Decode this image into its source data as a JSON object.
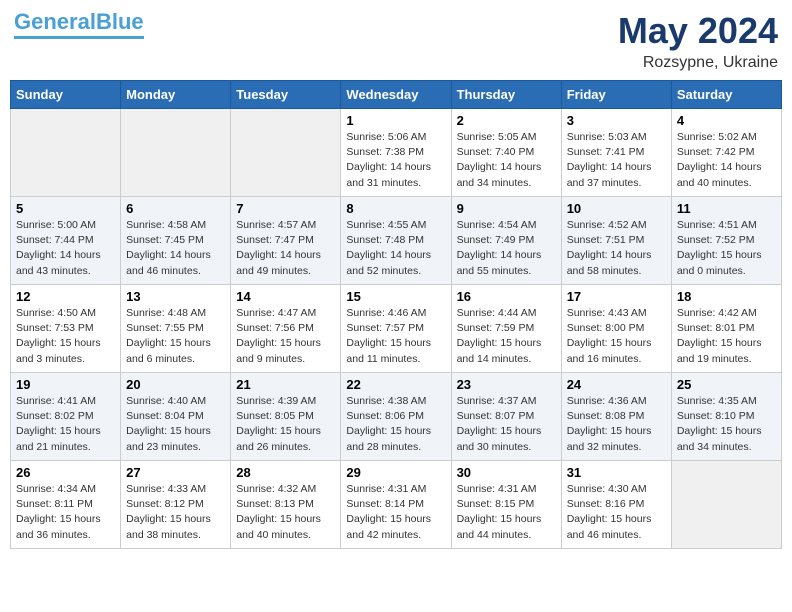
{
  "header": {
    "logo_line1": "General",
    "logo_line2": "Blue",
    "month": "May 2024",
    "location": "Rozsypne, Ukraine"
  },
  "weekdays": [
    "Sunday",
    "Monday",
    "Tuesday",
    "Wednesday",
    "Thursday",
    "Friday",
    "Saturday"
  ],
  "weeks": [
    [
      {
        "day": "",
        "empty": true
      },
      {
        "day": "",
        "empty": true
      },
      {
        "day": "",
        "empty": true
      },
      {
        "day": "1",
        "sunrise": "Sunrise: 5:06 AM",
        "sunset": "Sunset: 7:38 PM",
        "daylight": "Daylight: 14 hours and 31 minutes."
      },
      {
        "day": "2",
        "sunrise": "Sunrise: 5:05 AM",
        "sunset": "Sunset: 7:40 PM",
        "daylight": "Daylight: 14 hours and 34 minutes."
      },
      {
        "day": "3",
        "sunrise": "Sunrise: 5:03 AM",
        "sunset": "Sunset: 7:41 PM",
        "daylight": "Daylight: 14 hours and 37 minutes."
      },
      {
        "day": "4",
        "sunrise": "Sunrise: 5:02 AM",
        "sunset": "Sunset: 7:42 PM",
        "daylight": "Daylight: 14 hours and 40 minutes."
      }
    ],
    [
      {
        "day": "5",
        "sunrise": "Sunrise: 5:00 AM",
        "sunset": "Sunset: 7:44 PM",
        "daylight": "Daylight: 14 hours and 43 minutes."
      },
      {
        "day": "6",
        "sunrise": "Sunrise: 4:58 AM",
        "sunset": "Sunset: 7:45 PM",
        "daylight": "Daylight: 14 hours and 46 minutes."
      },
      {
        "day": "7",
        "sunrise": "Sunrise: 4:57 AM",
        "sunset": "Sunset: 7:47 PM",
        "daylight": "Daylight: 14 hours and 49 minutes."
      },
      {
        "day": "8",
        "sunrise": "Sunrise: 4:55 AM",
        "sunset": "Sunset: 7:48 PM",
        "daylight": "Daylight: 14 hours and 52 minutes."
      },
      {
        "day": "9",
        "sunrise": "Sunrise: 4:54 AM",
        "sunset": "Sunset: 7:49 PM",
        "daylight": "Daylight: 14 hours and 55 minutes."
      },
      {
        "day": "10",
        "sunrise": "Sunrise: 4:52 AM",
        "sunset": "Sunset: 7:51 PM",
        "daylight": "Daylight: 14 hours and 58 minutes."
      },
      {
        "day": "11",
        "sunrise": "Sunrise: 4:51 AM",
        "sunset": "Sunset: 7:52 PM",
        "daylight": "Daylight: 15 hours and 0 minutes."
      }
    ],
    [
      {
        "day": "12",
        "sunrise": "Sunrise: 4:50 AM",
        "sunset": "Sunset: 7:53 PM",
        "daylight": "Daylight: 15 hours and 3 minutes."
      },
      {
        "day": "13",
        "sunrise": "Sunrise: 4:48 AM",
        "sunset": "Sunset: 7:55 PM",
        "daylight": "Daylight: 15 hours and 6 minutes."
      },
      {
        "day": "14",
        "sunrise": "Sunrise: 4:47 AM",
        "sunset": "Sunset: 7:56 PM",
        "daylight": "Daylight: 15 hours and 9 minutes."
      },
      {
        "day": "15",
        "sunrise": "Sunrise: 4:46 AM",
        "sunset": "Sunset: 7:57 PM",
        "daylight": "Daylight: 15 hours and 11 minutes."
      },
      {
        "day": "16",
        "sunrise": "Sunrise: 4:44 AM",
        "sunset": "Sunset: 7:59 PM",
        "daylight": "Daylight: 15 hours and 14 minutes."
      },
      {
        "day": "17",
        "sunrise": "Sunrise: 4:43 AM",
        "sunset": "Sunset: 8:00 PM",
        "daylight": "Daylight: 15 hours and 16 minutes."
      },
      {
        "day": "18",
        "sunrise": "Sunrise: 4:42 AM",
        "sunset": "Sunset: 8:01 PM",
        "daylight": "Daylight: 15 hours and 19 minutes."
      }
    ],
    [
      {
        "day": "19",
        "sunrise": "Sunrise: 4:41 AM",
        "sunset": "Sunset: 8:02 PM",
        "daylight": "Daylight: 15 hours and 21 minutes."
      },
      {
        "day": "20",
        "sunrise": "Sunrise: 4:40 AM",
        "sunset": "Sunset: 8:04 PM",
        "daylight": "Daylight: 15 hours and 23 minutes."
      },
      {
        "day": "21",
        "sunrise": "Sunrise: 4:39 AM",
        "sunset": "Sunset: 8:05 PM",
        "daylight": "Daylight: 15 hours and 26 minutes."
      },
      {
        "day": "22",
        "sunrise": "Sunrise: 4:38 AM",
        "sunset": "Sunset: 8:06 PM",
        "daylight": "Daylight: 15 hours and 28 minutes."
      },
      {
        "day": "23",
        "sunrise": "Sunrise: 4:37 AM",
        "sunset": "Sunset: 8:07 PM",
        "daylight": "Daylight: 15 hours and 30 minutes."
      },
      {
        "day": "24",
        "sunrise": "Sunrise: 4:36 AM",
        "sunset": "Sunset: 8:08 PM",
        "daylight": "Daylight: 15 hours and 32 minutes."
      },
      {
        "day": "25",
        "sunrise": "Sunrise: 4:35 AM",
        "sunset": "Sunset: 8:10 PM",
        "daylight": "Daylight: 15 hours and 34 minutes."
      }
    ],
    [
      {
        "day": "26",
        "sunrise": "Sunrise: 4:34 AM",
        "sunset": "Sunset: 8:11 PM",
        "daylight": "Daylight: 15 hours and 36 minutes."
      },
      {
        "day": "27",
        "sunrise": "Sunrise: 4:33 AM",
        "sunset": "Sunset: 8:12 PM",
        "daylight": "Daylight: 15 hours and 38 minutes."
      },
      {
        "day": "28",
        "sunrise": "Sunrise: 4:32 AM",
        "sunset": "Sunset: 8:13 PM",
        "daylight": "Daylight: 15 hours and 40 minutes."
      },
      {
        "day": "29",
        "sunrise": "Sunrise: 4:31 AM",
        "sunset": "Sunset: 8:14 PM",
        "daylight": "Daylight: 15 hours and 42 minutes."
      },
      {
        "day": "30",
        "sunrise": "Sunrise: 4:31 AM",
        "sunset": "Sunset: 8:15 PM",
        "daylight": "Daylight: 15 hours and 44 minutes."
      },
      {
        "day": "31",
        "sunrise": "Sunrise: 4:30 AM",
        "sunset": "Sunset: 8:16 PM",
        "daylight": "Daylight: 15 hours and 46 minutes."
      },
      {
        "day": "",
        "empty": true
      }
    ]
  ]
}
